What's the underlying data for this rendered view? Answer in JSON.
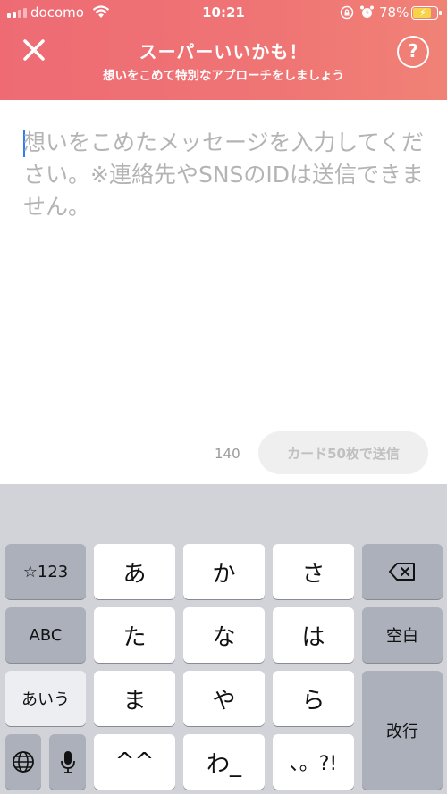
{
  "status_bar": {
    "carrier": "docomo",
    "time": "10:21",
    "battery": "78%",
    "battery_level": 0.78
  },
  "header": {
    "title": "スーパーいいかも！",
    "subtitle": "想いをこめて特別なアプローチをしましょう",
    "help_label": "?"
  },
  "message": {
    "placeholder": "想いをこめたメッセージを入力してください。※連絡先やSNSのIDは送信できません。",
    "value": "",
    "char_count": "140",
    "send_label": "カード50枚で送信"
  },
  "keyboard": {
    "mode_key": "☆123",
    "abc_key": "ABC",
    "kana_key": "あいう",
    "space_key": "空白",
    "return_key": "改行",
    "keys": [
      "あ",
      "か",
      "さ",
      "た",
      "な",
      "は",
      "ま",
      "や",
      "ら",
      "^^",
      "わ_",
      "、。?!"
    ]
  },
  "colors": {
    "header_gradient_start": "#ee6b74",
    "header_gradient_end": "#f08276",
    "caret": "#2f7cf6"
  }
}
